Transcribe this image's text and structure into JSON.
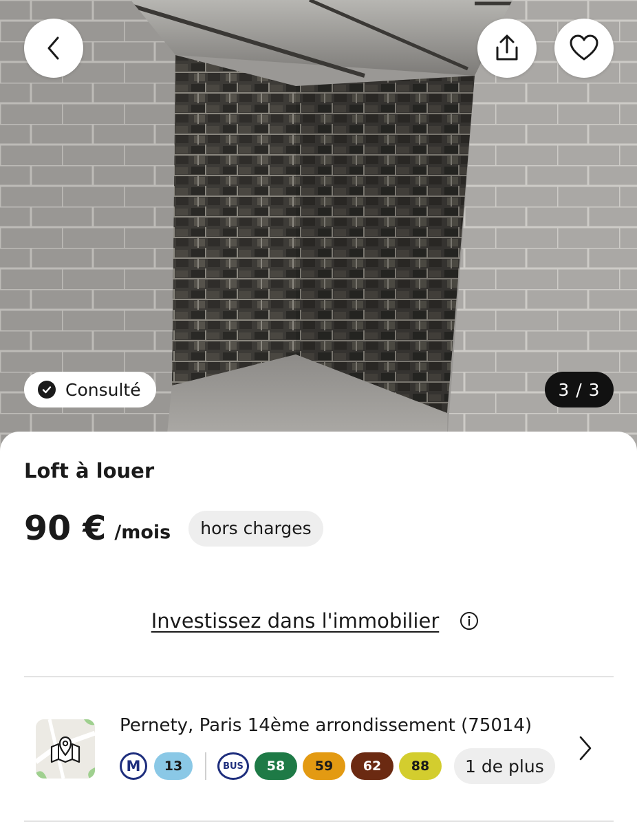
{
  "hero": {
    "viewed_label": "Consulté",
    "photo_counter": "3 / 3"
  },
  "listing": {
    "title": "Loft à louer",
    "price": "90 €",
    "period": "/mois",
    "charges": "hors charges"
  },
  "invest": {
    "link_label": "Investissez dans l'immobilier"
  },
  "location": {
    "address": "Pernety, Paris 14ème arrondissement (75014)",
    "metro_logo": "M",
    "metro_lines": [
      {
        "label": "13",
        "color": "#8ac8e6",
        "text_color": "#1a1a1a"
      }
    ],
    "bus_logo": "BUS",
    "bus_lines": [
      {
        "label": "58",
        "color": "#1e7a46",
        "text_color": "#ffffff"
      },
      {
        "label": "59",
        "color": "#e39a12",
        "text_color": "#1a1a1a"
      },
      {
        "label": "62",
        "color": "#6b2a12",
        "text_color": "#ffffff"
      },
      {
        "label": "88",
        "color": "#d3cd2e",
        "text_color": "#1a1a1a"
      }
    ],
    "more_label": "1 de plus"
  },
  "icons": {
    "back": "chevron-left-icon",
    "share": "share-icon",
    "favorite": "heart-icon",
    "viewed": "check-circle-icon",
    "info": "info-icon",
    "map": "map-pin-icon",
    "detail": "chevron-right-icon"
  }
}
